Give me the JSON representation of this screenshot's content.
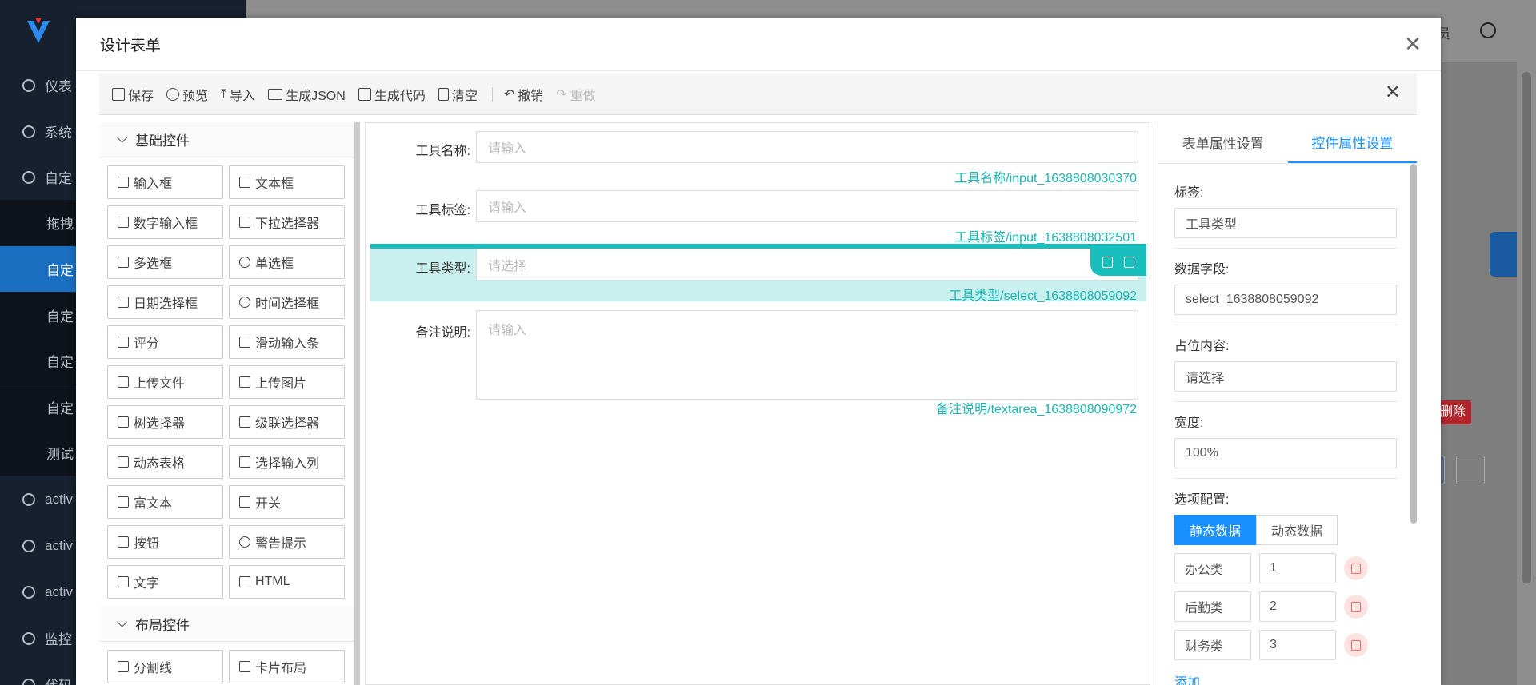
{
  "background": {
    "sidebar_items": [
      {
        "label": "仪表",
        "sub": false,
        "active": false
      },
      {
        "label": "系统",
        "sub": false,
        "active": false
      },
      {
        "label": "自定",
        "sub": false,
        "active": false
      },
      {
        "label": "拖拽",
        "sub": true,
        "active": false
      },
      {
        "label": "自定",
        "sub": true,
        "active": true
      },
      {
        "label": "自定",
        "sub": true,
        "active": false
      },
      {
        "label": "自定",
        "sub": true,
        "active": false
      },
      {
        "label": "自定",
        "sub": true,
        "active": false
      },
      {
        "label": "测试",
        "sub": true,
        "active": false
      },
      {
        "label": "activ",
        "sub": false,
        "active": false
      },
      {
        "label": "activ",
        "sub": false,
        "active": false
      },
      {
        "label": "activ",
        "sub": false,
        "active": false
      },
      {
        "label": "监控",
        "sub": false,
        "active": false
      },
      {
        "label": "代码",
        "sub": false,
        "active": false
      }
    ],
    "user_label": "员",
    "delete_label": "删除"
  },
  "modal": {
    "title": "设计表单",
    "toolbar": {
      "save": "保存",
      "preview": "预览",
      "import": "导入",
      "gen_json": "生成JSON",
      "gen_code": "生成代码",
      "clear": "清空",
      "undo": "撤销",
      "redo": "重做"
    },
    "groups": [
      {
        "title": "基础控件",
        "items": [
          {
            "label": "输入框",
            "icon": "edit-icon"
          },
          {
            "label": "文本框",
            "icon": "textarea-icon"
          },
          {
            "label": "数字输入框",
            "icon": "number-icon"
          },
          {
            "label": "下拉选择器",
            "icon": "select-icon"
          },
          {
            "label": "多选框",
            "icon": "checkbox-icon"
          },
          {
            "label": "单选框",
            "icon": "radio-icon"
          },
          {
            "label": "日期选择框",
            "icon": "date-icon"
          },
          {
            "label": "时间选择框",
            "icon": "clock-icon"
          },
          {
            "label": "评分",
            "icon": "star-icon"
          },
          {
            "label": "滑动输入条",
            "icon": "slider-icon"
          },
          {
            "label": "上传文件",
            "icon": "upload-icon"
          },
          {
            "label": "上传图片",
            "icon": "image-icon"
          },
          {
            "label": "树选择器",
            "icon": "tree-icon"
          },
          {
            "label": "级联选择器",
            "icon": "cascader-icon"
          },
          {
            "label": "动态表格",
            "icon": "table-icon"
          },
          {
            "label": "选择输入列",
            "icon": "grid-icon"
          },
          {
            "label": "富文本",
            "icon": "richtext-icon"
          },
          {
            "label": "开关",
            "icon": "switch-icon"
          },
          {
            "label": "按钮",
            "icon": "button-icon"
          },
          {
            "label": "警告提示",
            "icon": "alert-icon"
          },
          {
            "label": "文字",
            "icon": "text-icon"
          },
          {
            "label": "HTML",
            "icon": "code-icon"
          }
        ]
      },
      {
        "title": "布局控件",
        "items": [
          {
            "label": "分割线",
            "icon": "divider-icon"
          },
          {
            "label": "卡片布局",
            "icon": "card-icon"
          }
        ]
      }
    ],
    "canvas_fields": [
      {
        "label": "工具名称:",
        "placeholder": "请输入",
        "meta": "工具名称/input_1638808030370",
        "type": "input",
        "selected": false
      },
      {
        "label": "工具标签:",
        "placeholder": "请输入",
        "meta": "工具标签/input_1638808032501",
        "type": "input",
        "selected": false
      },
      {
        "label": "工具类型:",
        "placeholder": "请选择",
        "meta": "工具类型/select_1638808059092",
        "type": "select",
        "selected": true
      },
      {
        "label": "备注说明:",
        "placeholder": "请输入",
        "meta": "备注说明/textarea_1638808090972",
        "type": "textarea",
        "selected": false
      }
    ],
    "right_panel": {
      "tabs": [
        {
          "label": "表单属性设置",
          "active": false
        },
        {
          "label": "控件属性设置",
          "active": true
        }
      ],
      "label_title": "标签:",
      "label_value": "工具类型",
      "field_title": "数据字段:",
      "field_value": "select_1638808059092",
      "placeholder_title": "占位内容:",
      "placeholder_value": "请选择",
      "width_title": "宽度:",
      "width_value": "100%",
      "options_title": "选项配置:",
      "static_btn": "静态数据",
      "dynamic_btn": "动态数据",
      "options": [
        {
          "label": "办公类",
          "value": "1"
        },
        {
          "label": "后勤类",
          "value": "2"
        },
        {
          "label": "财务类",
          "value": "3"
        }
      ],
      "add_label": "添加"
    }
  }
}
